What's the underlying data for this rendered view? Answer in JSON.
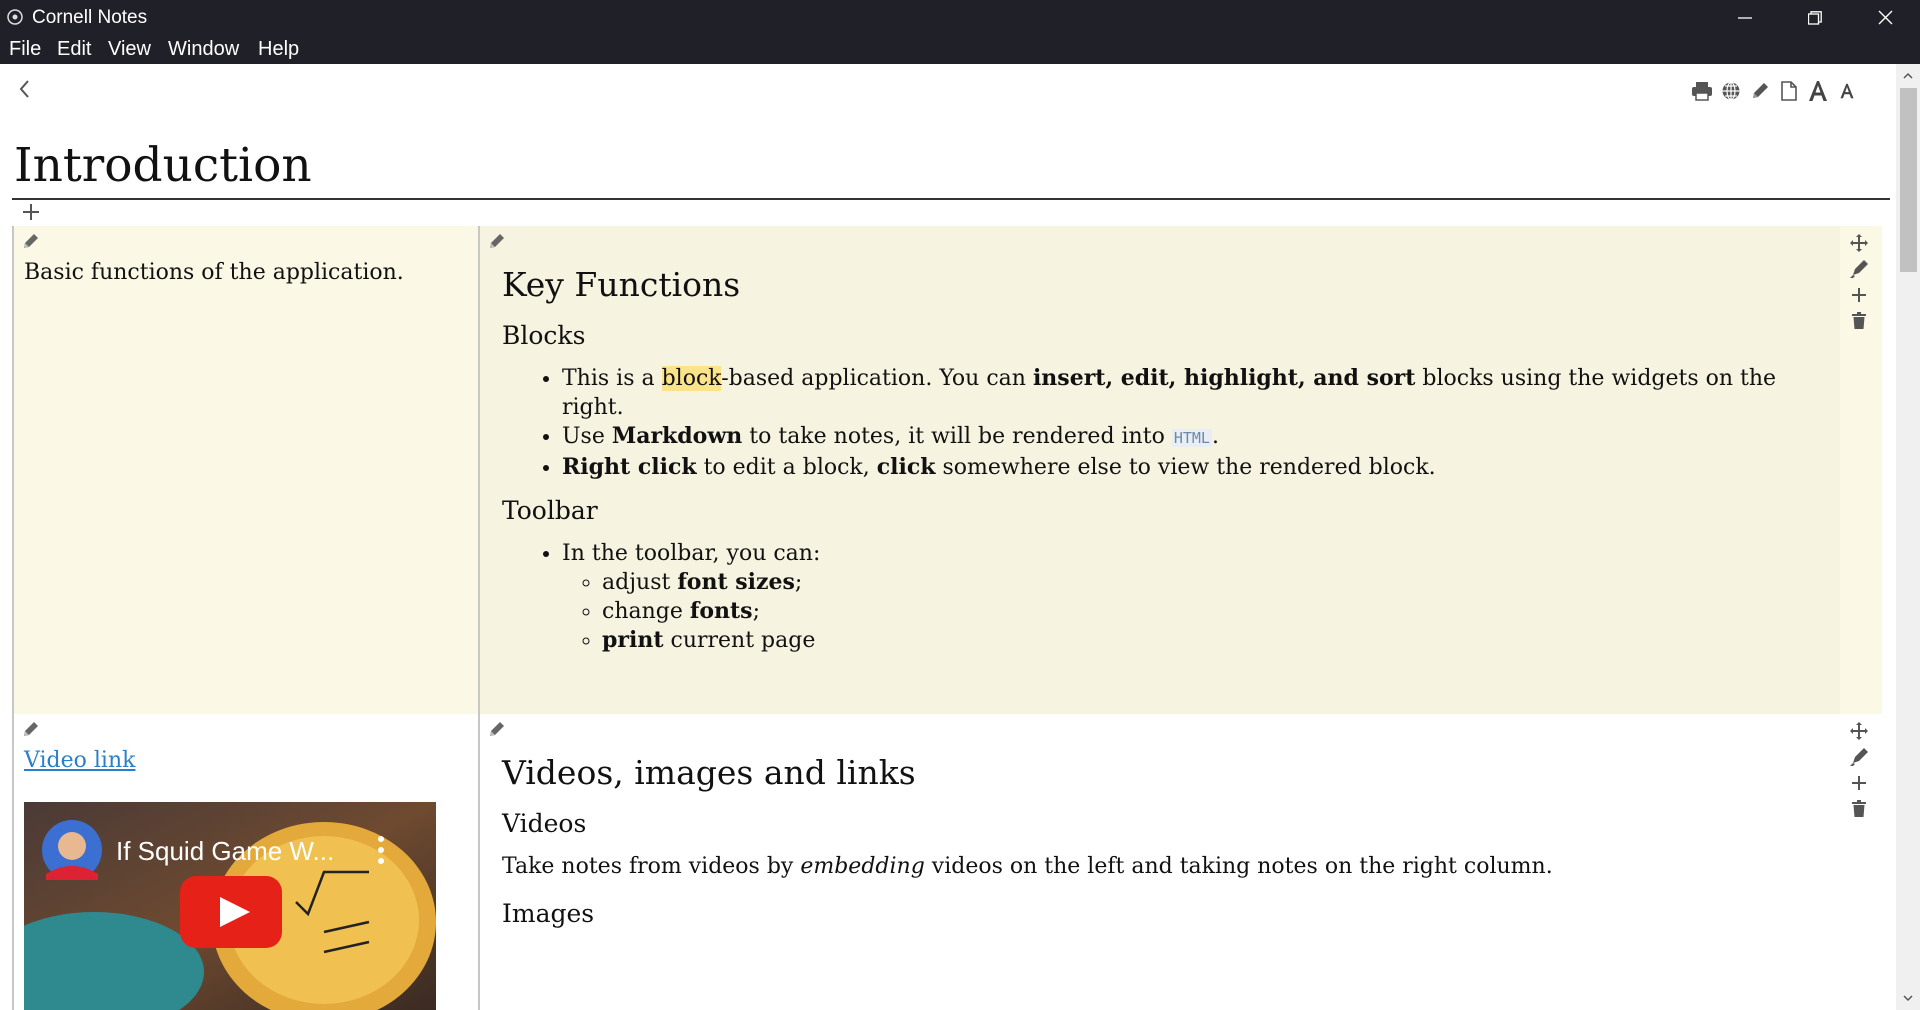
{
  "window": {
    "title": "Cornell Notes"
  },
  "menu": {
    "file": "File",
    "edit": "Edit",
    "view": "View",
    "window": "Window",
    "help": "Help"
  },
  "page": {
    "title": "Introduction"
  },
  "block1": {
    "left_text": "Basic functions of the application.",
    "h2": "Key Functions",
    "h3_blocks": "Blocks",
    "b1_pre": "This is a ",
    "b1_hl": "block",
    "b1_mid": "-based application. You can ",
    "b1_bold": "insert, edit, highlight, and sort",
    "b1_post": " blocks using the widgets on the right.",
    "b2_pre": "Use ",
    "b2_bold": "Markdown",
    "b2_mid": " to take notes, it will be rendered into ",
    "b2_code": "HTML",
    "b2_post": ".",
    "b3_bold1": "Right click",
    "b3_mid": " to edit a block, ",
    "b3_bold2": "click",
    "b3_post": " somewhere else to view the rendered block.",
    "h3_toolbar": "Toolbar",
    "tb_intro": "In the toolbar, you can:",
    "tb1_pre": "adjust ",
    "tb1_bold": "font sizes",
    "tb1_post": ";",
    "tb2_pre": "change ",
    "tb2_bold": "fonts",
    "tb2_post": ";",
    "tb3_bold": "print",
    "tb3_post": " current page"
  },
  "block2": {
    "video_link": "Video link",
    "video_title": "If Squid Game W...",
    "h2": "Videos, images and links",
    "h3_videos": "Videos",
    "p_pre": "Take notes from videos by ",
    "p_em": "embedding",
    "p_post": " videos on the left and taking notes on the right column.",
    "h3_images": "Images"
  },
  "icons": {
    "toolbar": [
      "print-icon",
      "globe-icon",
      "pencil-icon",
      "file-icon",
      "font-size-increase-icon",
      "font-size-decrease-icon"
    ],
    "widgets": [
      "move-icon",
      "highlight-icon",
      "add-icon",
      "trash-icon"
    ]
  }
}
